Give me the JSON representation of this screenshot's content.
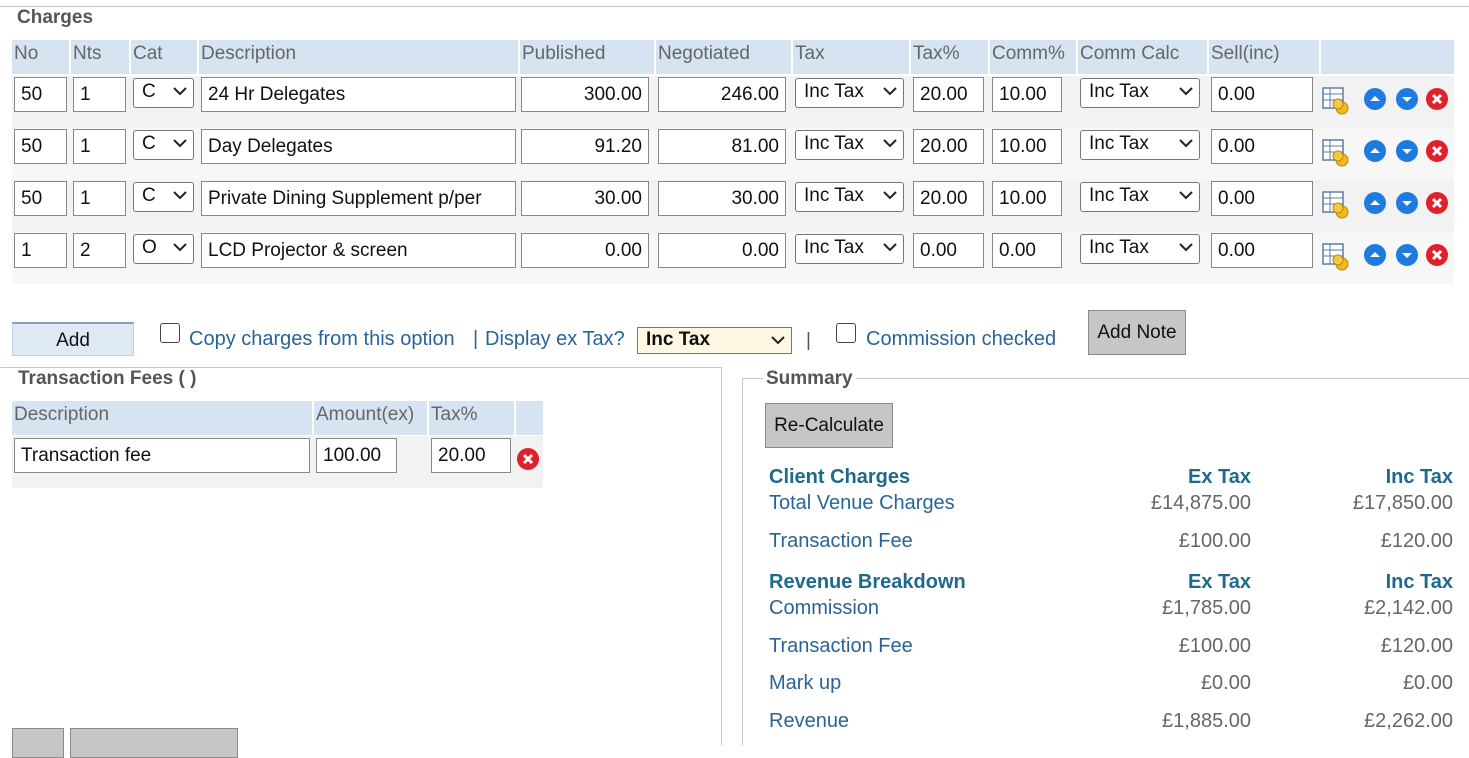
{
  "charges": {
    "legend": "Charges",
    "headers": {
      "no": "No",
      "nts": "Nts",
      "cat": "Cat",
      "description": "Description",
      "published": "Published",
      "negotiated": "Negotiated",
      "tax": "Tax",
      "taxpct": "Tax%",
      "commpct": "Comm%",
      "commcalc": "Comm Calc",
      "sell": "Sell(inc)"
    },
    "rows": [
      {
        "no": "50",
        "nts": "1",
        "cat": "C",
        "description": "24 Hr Delegates",
        "published": "300.00",
        "negotiated": "246.00",
        "tax": "Inc Tax",
        "taxpct": "20.00",
        "commpct": "10.00",
        "commcalc": "Inc Tax",
        "sell": "0.00"
      },
      {
        "no": "50",
        "nts": "1",
        "cat": "C",
        "description": "Day Delegates",
        "published": "91.20",
        "negotiated": "81.00",
        "tax": "Inc Tax",
        "taxpct": "20.00",
        "commpct": "10.00",
        "commcalc": "Inc Tax",
        "sell": "0.00"
      },
      {
        "no": "50",
        "nts": "1",
        "cat": "C",
        "description": "Private Dining Supplement p/per",
        "published": "30.00",
        "negotiated": "30.00",
        "tax": "Inc Tax",
        "taxpct": "20.00",
        "commpct": "10.00",
        "commcalc": "Inc Tax",
        "sell": "0.00"
      },
      {
        "no": "1",
        "nts": "2",
        "cat": "O",
        "description": "LCD Projector & screen",
        "published": "0.00",
        "negotiated": "0.00",
        "tax": "Inc Tax",
        "taxpct": "0.00",
        "commpct": "0.00",
        "commcalc": "Inc Tax",
        "sell": "0.00"
      }
    ],
    "toolbar": {
      "add_label": "Add",
      "copy_label": "Copy charges from this option",
      "separator": "|",
      "display_ex_tax_label": "Display ex Tax?",
      "display_tax_value": "Inc Tax",
      "separator2": "|",
      "commission_checked_label": "Commission checked",
      "add_note_label": "Add Note"
    }
  },
  "transaction_fees": {
    "legend": "Transaction Fees ( )",
    "headers": {
      "description": "Description",
      "amount": "Amount(ex)",
      "taxpct": "Tax%"
    },
    "rows": [
      {
        "description": "Transaction fee",
        "amount": "100.00",
        "taxpct": "20.00"
      }
    ]
  },
  "summary": {
    "legend": "Summary",
    "recalc_label": "Re-Calculate",
    "client_charges": {
      "heading": "Client Charges",
      "ex_heading": "Ex Tax",
      "inc_heading": "Inc Tax",
      "rows": [
        {
          "label": "Total Venue Charges",
          "ex": "£14,875.00",
          "inc": "£17,850.00"
        },
        {
          "label": "Transaction Fee",
          "ex": "£100.00",
          "inc": "£120.00"
        }
      ]
    },
    "revenue": {
      "heading": "Revenue Breakdown",
      "ex_heading": "Ex Tax",
      "inc_heading": "Inc Tax",
      "rows": [
        {
          "label": "Commission",
          "ex": "£1,785.00",
          "inc": "£2,142.00"
        },
        {
          "label": "Transaction Fee",
          "ex": "£100.00",
          "inc": "£120.00"
        },
        {
          "label": "Mark up",
          "ex": "£0.00",
          "inc": "£0.00"
        },
        {
          "label": "Revenue",
          "ex": "£1,885.00",
          "inc": "£2,262.00"
        }
      ]
    }
  },
  "colors": {
    "header_bg": "#d6e3f1",
    "link": "#2a6496",
    "summary_head": "#1e6a8c",
    "delete": "#e0202a",
    "move": "#1f7be0"
  }
}
